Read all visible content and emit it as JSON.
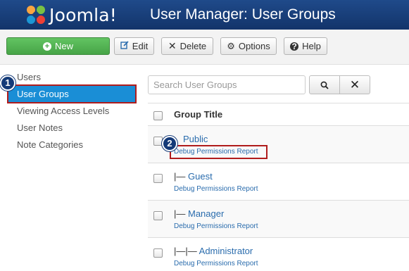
{
  "header": {
    "logo_text": "Joomla!",
    "title": "User Manager: User Groups"
  },
  "toolbar": {
    "new_label": "New",
    "edit_label": "Edit",
    "delete_label": "Delete",
    "options_label": "Options",
    "help_label": "Help"
  },
  "sidebar": {
    "items": [
      {
        "label": "Users"
      },
      {
        "label": "User Groups",
        "active": true
      },
      {
        "label": "Viewing Access Levels"
      },
      {
        "label": "User Notes"
      },
      {
        "label": "Note Categories"
      }
    ]
  },
  "callouts": [
    "1",
    "2"
  ],
  "search": {
    "placeholder": "Search User Groups",
    "value": ""
  },
  "table": {
    "header_title": "Group Title",
    "rows": [
      {
        "prefix": "",
        "name": "Public",
        "debug_label": "Debug Permissions Report"
      },
      {
        "prefix": "|— ",
        "name": "Guest",
        "debug_label": "Debug Permissions Report"
      },
      {
        "prefix": "|— ",
        "name": "Manager",
        "debug_label": "Debug Permissions Report"
      },
      {
        "prefix": "|—|— ",
        "name": "Administrator",
        "debug_label": "Debug Permissions Report"
      }
    ]
  },
  "colors": {
    "header_bg": "#1a3f7a",
    "new_button": "#51b151",
    "active_item": "#1a8ed6",
    "highlight_border": "#b01c1c",
    "link": "#2a6cad"
  }
}
